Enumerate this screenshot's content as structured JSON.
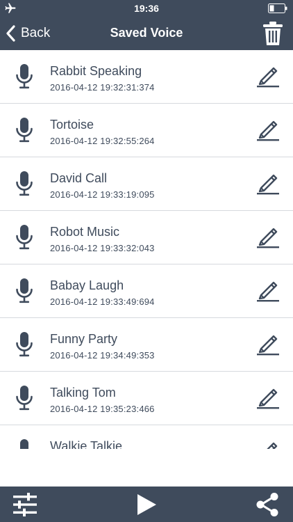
{
  "status_bar": {
    "time": "19:36",
    "airplane_icon": "airplane-icon",
    "battery_icon": "battery-icon"
  },
  "nav": {
    "back_label": "Back",
    "title": "Saved Voice",
    "trash_icon": "trash-icon"
  },
  "colors": {
    "bar": "#3f4b5c",
    "text": "#3f4b5c",
    "divider": "#d6d9de",
    "background": "#ffffff"
  },
  "recordings": [
    {
      "name": "Rabbit Speaking",
      "date": "2016-04-12 19:32:31:374"
    },
    {
      "name": "Tortoise",
      "date": "2016-04-12 19:32:55:264"
    },
    {
      "name": "David Call",
      "date": "2016-04-12 19:33:19:095"
    },
    {
      "name": "Robot Music",
      "date": "2016-04-12 19:33:32:043"
    },
    {
      "name": "Babay Laugh",
      "date": "2016-04-12 19:33:49:694"
    },
    {
      "name": "Funny Party",
      "date": "2016-04-12 19:34:49:353"
    },
    {
      "name": "Talking Tom",
      "date": "2016-04-12 19:35:23:466"
    },
    {
      "name": "Walkie Talkie",
      "date": ""
    }
  ],
  "toolbar": {
    "settings_icon": "sliders-icon",
    "play_icon": "play-icon",
    "share_icon": "share-icon"
  }
}
